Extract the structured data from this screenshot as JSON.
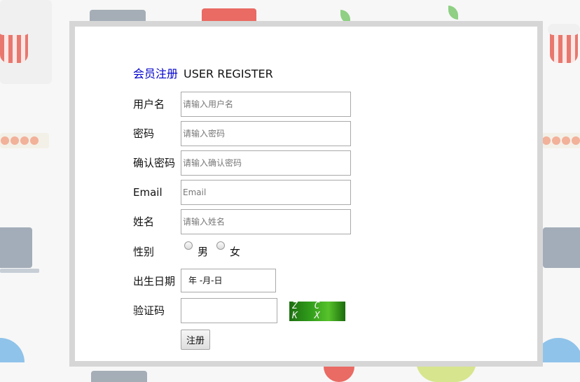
{
  "title": {
    "cn": "会员注册",
    "en": "USER REGISTER"
  },
  "fields": [
    {
      "label": "用户名",
      "placeholder": "请输入用户名"
    },
    {
      "label": "密码",
      "placeholder": "请输入密码"
    },
    {
      "label": "确认密码",
      "placeholder": "请输入确认密码"
    },
    {
      "label": "Email",
      "placeholder": "Email"
    },
    {
      "label": "姓名",
      "placeholder": "请输入姓名"
    }
  ],
  "gender": {
    "label": "性别",
    "options": [
      "男",
      "女"
    ]
  },
  "birthday": {
    "label": "出生日期",
    "value": "年 -月-日"
  },
  "captcha": {
    "label": "验证码",
    "image_text": "Z C K X"
  },
  "submit_label": "注册",
  "colors": {
    "title_link": "#0000cc",
    "panel_border": "#d6d6d6",
    "captcha_green": "#2f9a1a"
  }
}
